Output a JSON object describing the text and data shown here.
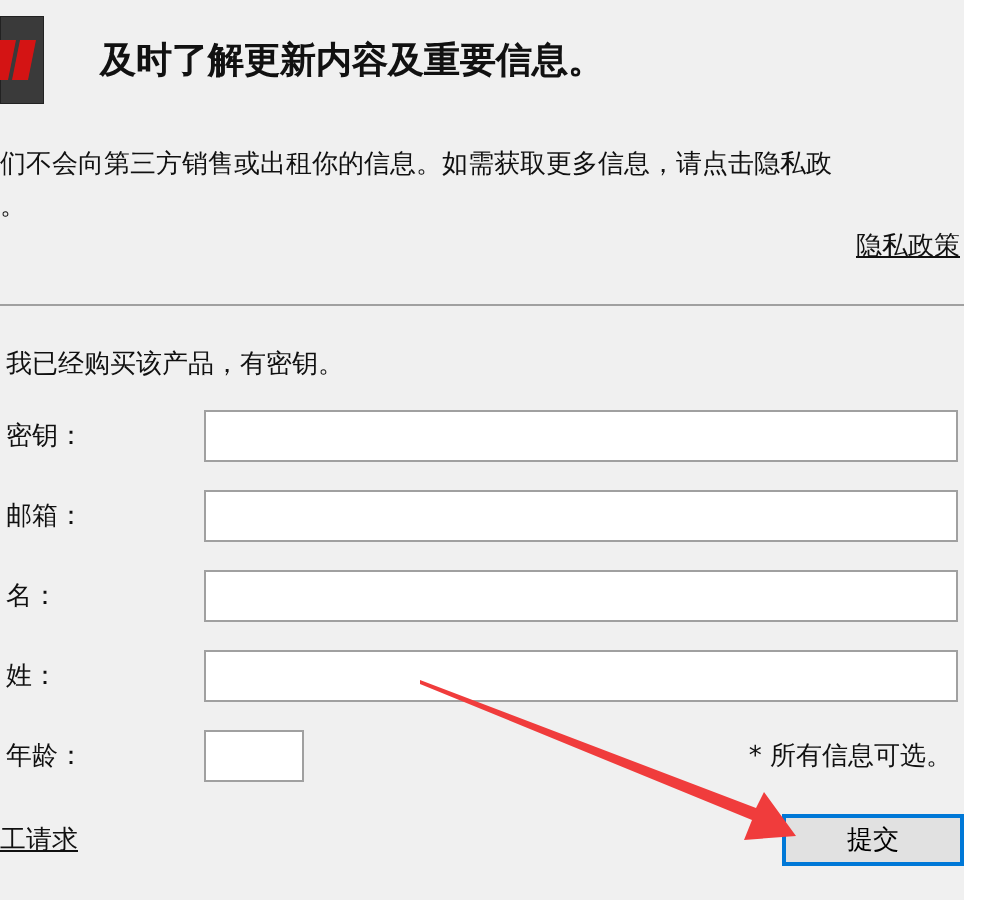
{
  "header": {
    "title": "及时了解更新内容及重要信息。"
  },
  "notice": {
    "lines": [
      "们不会向第三方销售或出租你的信息。如需获取更多信息，请点击隐私政",
      "。"
    ],
    "link": "隐私政策"
  },
  "purchased_label": "我已经购买该产品，有密钥。",
  "fields": [
    {
      "label": "密钥：",
      "kind": "wide"
    },
    {
      "label": "邮箱：",
      "kind": "wide"
    },
    {
      "label": "名：",
      "kind": "wide"
    },
    {
      "label": "姓：",
      "kind": "wide"
    },
    {
      "label": "年龄：",
      "kind": "short"
    }
  ],
  "optional_note": "* 所有信息可选。",
  "footer": {
    "link": "工请求",
    "submit": "提交"
  }
}
